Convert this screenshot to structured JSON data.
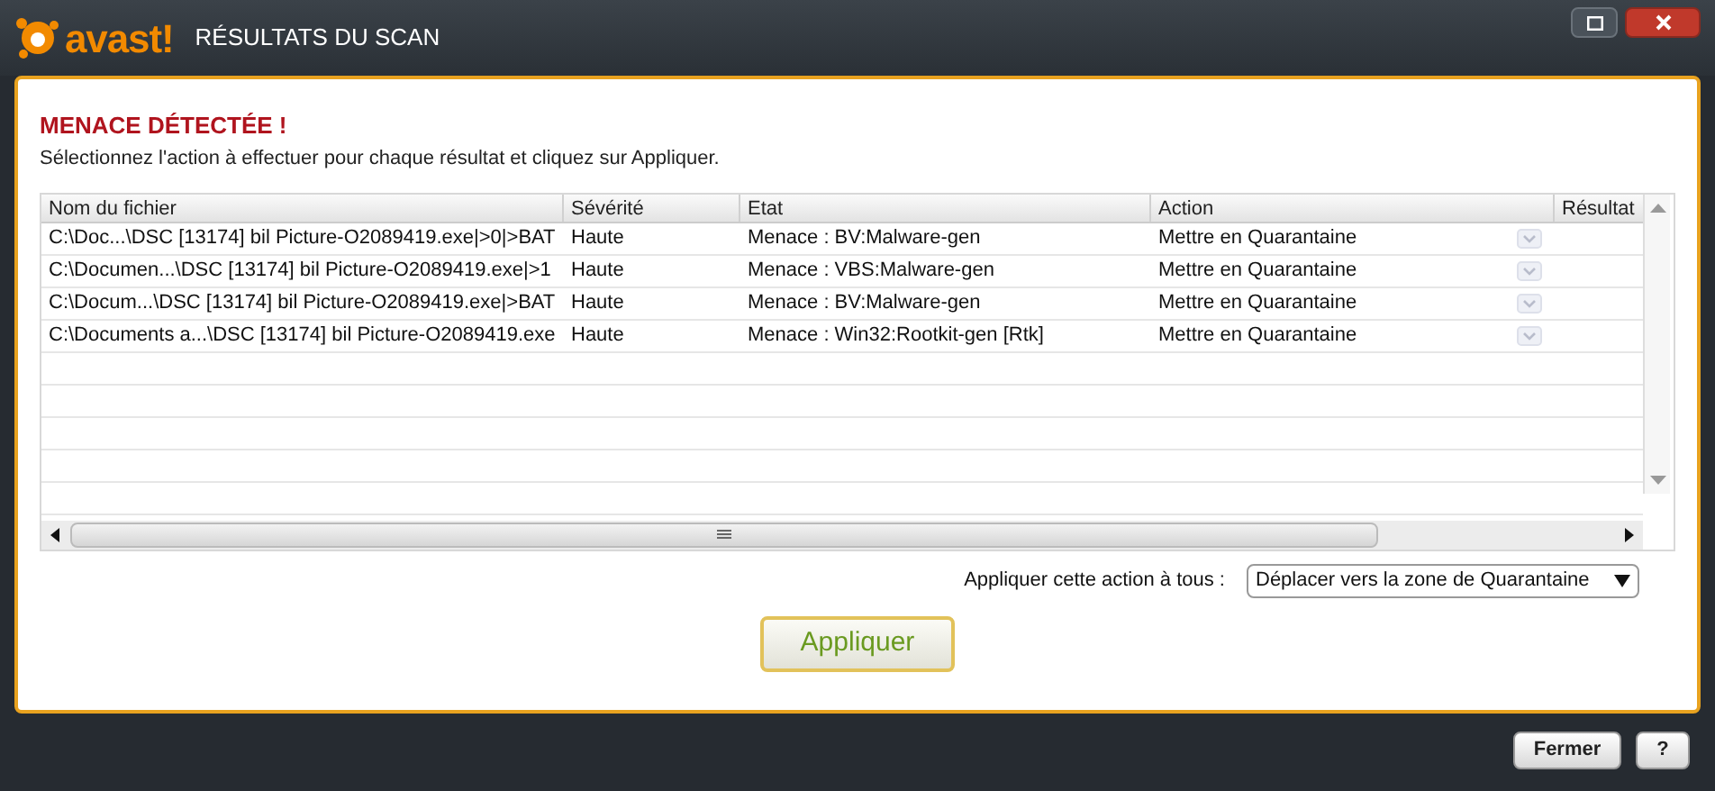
{
  "window": {
    "logo": "avast!",
    "title": "RÉSULTATS DU SCAN"
  },
  "heading": "MENACE DÉTECTÉE !",
  "instruction": "Sélectionnez l'action à effectuer pour chaque résultat et cliquez sur Appliquer.",
  "table": {
    "columns": [
      "Nom du fichier",
      "Sévérité",
      "Etat",
      "Action",
      "Résultat"
    ],
    "rows": [
      {
        "file": "C:\\Doc...\\DSC [13174] bil Picture-O2089419.exe|>0|>BAT",
        "severity": "Haute",
        "state": "Menace : BV:Malware-gen",
        "action": "Mettre en Quarantaine"
      },
      {
        "file": "C:\\Documen...\\DSC [13174] bil Picture-O2089419.exe|>1",
        "severity": "Haute",
        "state": "Menace : VBS:Malware-gen",
        "action": "Mettre en Quarantaine"
      },
      {
        "file": "C:\\Docum...\\DSC [13174] bil Picture-O2089419.exe|>BAT",
        "severity": "Haute",
        "state": "Menace : BV:Malware-gen",
        "action": "Mettre en Quarantaine"
      },
      {
        "file": "C:\\Documents a...\\DSC [13174] bil Picture-O2089419.exe",
        "severity": "Haute",
        "state": "Menace : Win32:Rootkit-gen [Rtk]",
        "action": "Mettre en Quarantaine"
      }
    ]
  },
  "apply_all": {
    "label": "Appliquer cette action à tous :",
    "value": "Déplacer vers la zone de Quarantaine"
  },
  "apply_button": "Appliquer",
  "footer_buttons": [
    "Fermer",
    "?"
  ]
}
